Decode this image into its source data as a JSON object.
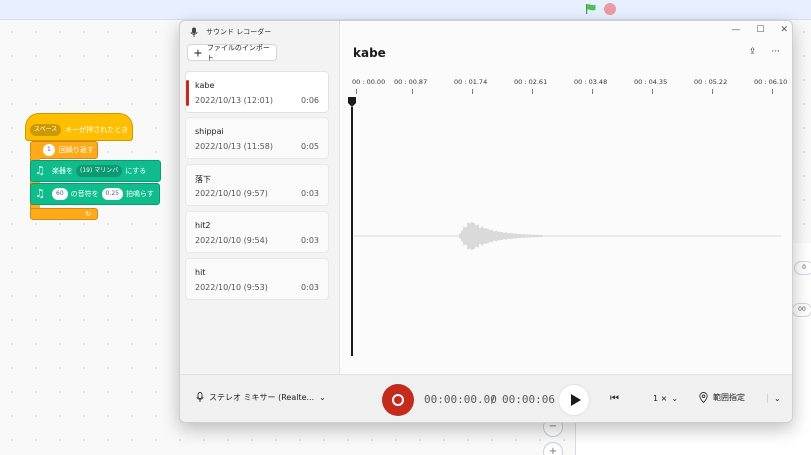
{
  "scratch": {
    "event_dropdown": "スペース",
    "event_text": "キーが押されたとき",
    "repeat_count": "1",
    "repeat_text": "回繰り返す",
    "instrument_prefix": "楽器を",
    "instrument_value": "(19) マリンバ",
    "instrument_suffix": "にする",
    "note_value": "60",
    "note_mid": "の音符を",
    "beats_value": "0.25",
    "beats_suffix": "拍鳴らす",
    "loop_arrow": "↻",
    "right_field_1": "0",
    "right_field_2": "00",
    "zoom_in": "+",
    "zoom_out": "−"
  },
  "app": {
    "title": "サウンド レコーダー",
    "import_icon": "plus-icon",
    "import_label": "ファイルのインポート",
    "recordings": [
      {
        "name": "kabe",
        "date": "2022/10/13 (12:01)",
        "duration": "0:06",
        "selected": true
      },
      {
        "name": "shippai",
        "date": "2022/10/13 (11:58)",
        "duration": "0:05"
      },
      {
        "name": "落下",
        "date": "2022/10/10 (9:57)",
        "duration": "0:03"
      },
      {
        "name": "hit2",
        "date": "2022/10/10 (9:54)",
        "duration": "0:03"
      },
      {
        "name": "hit",
        "date": "2022/10/10 (9:53)",
        "duration": "0:03"
      }
    ],
    "main_title": "kabe",
    "window_controls": {
      "minimize": "—",
      "maximize": "☐",
      "close": "✕"
    },
    "actions": {
      "share": "⇪",
      "more": "···"
    },
    "timeline_ticks": [
      "00 : 00.00",
      "00 : 00.87",
      "00 : 01.74",
      "00 : 02.61",
      "00 : 03.48",
      "00 : 04.35",
      "00 : 05.22",
      "00 : 06.10"
    ],
    "mic_device": "ステレオ ミキサー (Realte...",
    "mic_chevron": "⌄",
    "time_current": "00:00:00.00",
    "time_separator": "/",
    "time_total": "00:00:06",
    "skip_back_icon": "⏮",
    "speed_value": "1 ×",
    "speed_chevron": "⌄",
    "range_icon": "pin-icon",
    "range_label": "範囲指定",
    "range_chevron": "⌄"
  },
  "colors": {
    "record": "#c42b1c",
    "selection_bar": "#c42b1c",
    "event_block": "#ffbf00",
    "control_block": "#ffab19",
    "music_block": "#0fbd8c"
  }
}
